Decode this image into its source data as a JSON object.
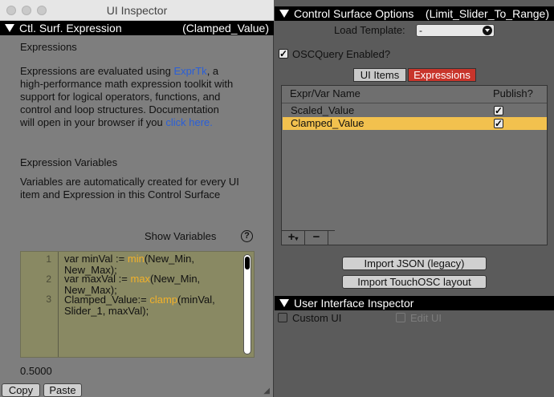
{
  "window": {
    "title": "UI Inspector"
  },
  "left_header": {
    "left": "Ctl. Surf. Expression",
    "right": "(Clamped_Value)"
  },
  "section_expressions": {
    "heading": "Expressions",
    "desc_lines": [
      "Expressions are evaluated using ",
      "high-performance math expression toolkit with",
      "support for logical operators, functions, and",
      "control and loop structures.  Documentation",
      "will open in your browser if you "
    ],
    "link_exprtk": "ExprTk",
    "after_link": ", a",
    "link_click": "click here."
  },
  "section_variables": {
    "heading": "Expression Variables",
    "desc_lines": [
      "Variables are automatically created for every UI",
      "item and Expression in this Control Surface"
    ],
    "show_variables": "Show Variables",
    "help_symbol": "?"
  },
  "editor": {
    "line_numbers": [
      "1",
      "2",
      "3"
    ],
    "line1a": "var minVal := ",
    "line1_fn": "min",
    "line1b": "(New_Min,",
    "line1c": "New_Max);",
    "line2a": "var maxVal := ",
    "line2_fn": "max",
    "line2b": "(New_Min,",
    "line2c": "New_Max);",
    "line3a": "Clamped_Value:= ",
    "line3_fn": "clamp",
    "line3b": "(minVal,",
    "line3c": "Slider_1, maxVal);"
  },
  "value": "0.5000",
  "buttons": {
    "copy": "Copy",
    "paste": "Paste"
  },
  "right_header": {
    "left": "Control Surface Options",
    "right": "(Limit_Slider_To_Range)"
  },
  "load_template": {
    "label": "Load Template:",
    "value": "-"
  },
  "oscquery": {
    "label": "OSCQuery Enabled?",
    "checked": true
  },
  "tabs": {
    "ui_items": "UI Items",
    "expressions": "Expressions"
  },
  "list": {
    "col_name": "Expr/Var Name",
    "col_publish": "Publish?",
    "rows": [
      {
        "name": "Scaled_Value",
        "publish": true
      },
      {
        "name": "Clamped_Value",
        "publish": true
      }
    ],
    "add": "+",
    "add_caret": "▾",
    "remove": "−"
  },
  "import_json": "Import JSON (legacy)",
  "import_touchosc": "Import TouchOSC layout",
  "uii_header": "User Interface Inspector",
  "custom_ui": "Custom UI",
  "edit_ui": "Edit UI",
  "colors": {
    "selected_row": "#f2c14e",
    "active_tab": "#c8352b",
    "link": "#2a5fd8",
    "function": "#f2b12a"
  }
}
